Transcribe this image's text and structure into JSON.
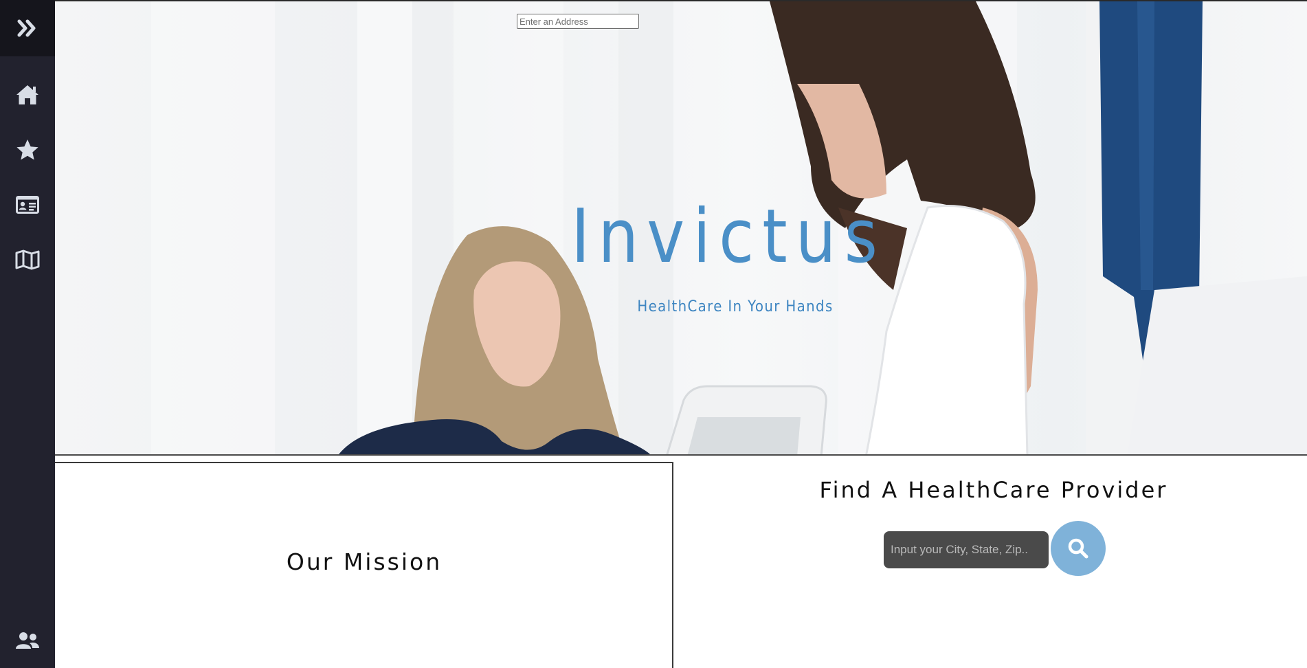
{
  "sidebar": {
    "toggle_icon": "double-chevron-right-icon",
    "items": [
      {
        "icon": "home-icon"
      },
      {
        "icon": "star-icon"
      },
      {
        "icon": "id-card-icon"
      },
      {
        "icon": "map-icon"
      }
    ],
    "footer_icon": "users-icon"
  },
  "hero": {
    "address_placeholder": "Enter an Address",
    "title": "Invictus",
    "tagline": "HealthCare In Your Hands"
  },
  "mission": {
    "title": "Our Mission"
  },
  "provider_search": {
    "title": "Find A HealthCare Provider",
    "input_placeholder": "Input your City, State, Zip..",
    "button_icon": "search-icon"
  },
  "colors": {
    "sidebar_bg": "#22222e",
    "accent_blue": "#4a8fc7",
    "search_button": "#7fb2d9",
    "input_bg": "#4a4a4a"
  }
}
